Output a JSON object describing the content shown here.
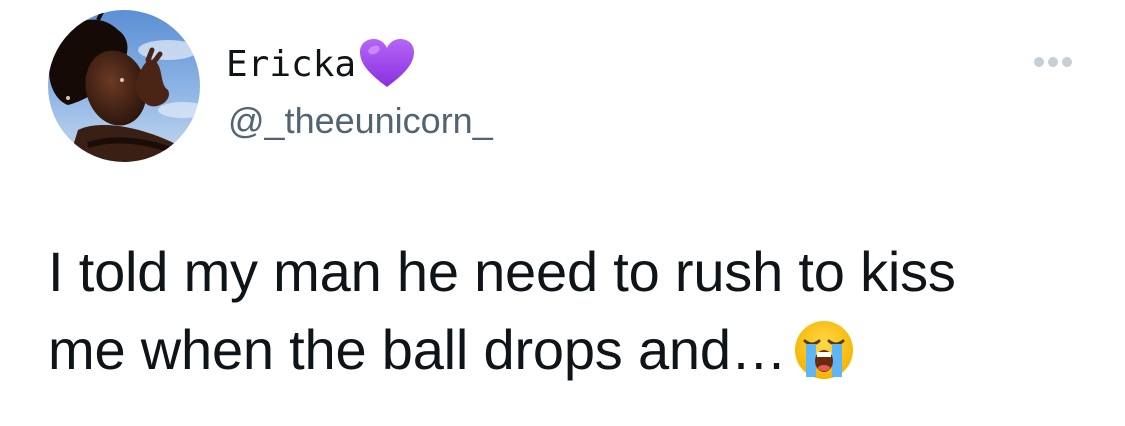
{
  "author": {
    "display_name": "Ericka",
    "name_emoji": "purple-heart-icon",
    "handle": "@_theeunicorn_",
    "avatar": "profile-photo"
  },
  "tweet": {
    "line1": "I told my man he need to rush to kiss",
    "line2": "me when the ball drops and…",
    "trailing_emoji": "loudly-crying-face-icon"
  },
  "actions": {
    "more_icon": "more-options-icon"
  },
  "colors": {
    "text_primary": "#0f1419",
    "text_secondary": "#536471",
    "more_dots": "#c4cfd6",
    "heart": "#a64df0"
  }
}
